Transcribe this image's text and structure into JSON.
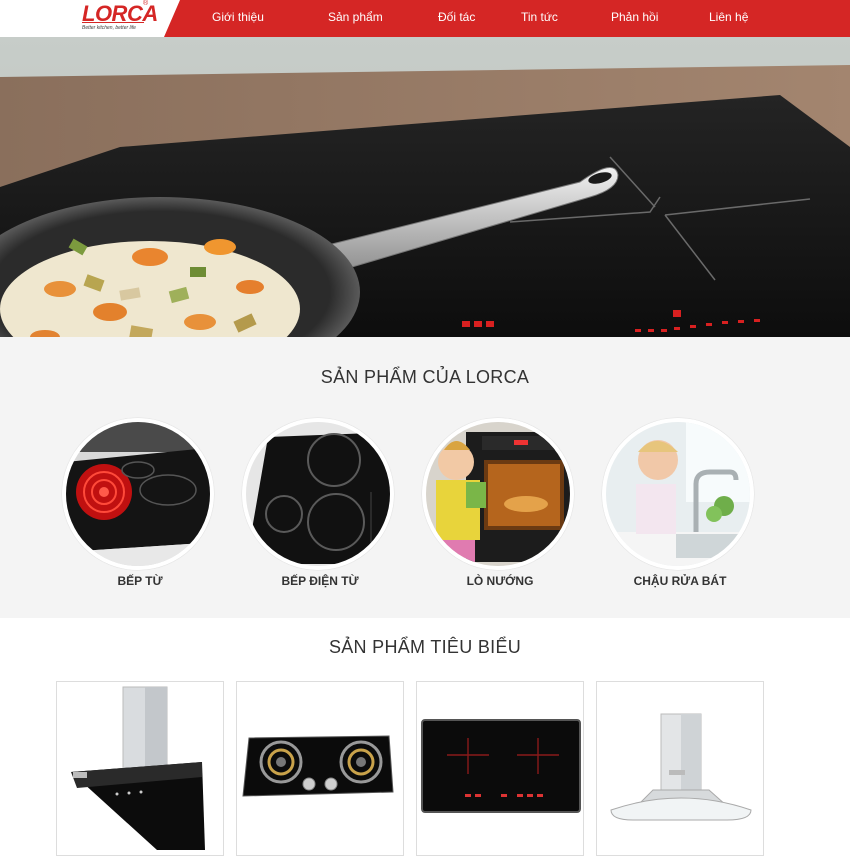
{
  "brand": {
    "name": "LORCA",
    "registered": "®",
    "tagline": "Better kitchen, better life"
  },
  "nav": {
    "items": [
      {
        "label": "Giới thiệu"
      },
      {
        "label": "Sản phẩm"
      },
      {
        "label": "Đối tác"
      },
      {
        "label": "Tin tức"
      },
      {
        "label": "Phản hồi"
      },
      {
        "label": "Liên hệ"
      }
    ]
  },
  "colors": {
    "brand_red": "#d52625",
    "section_bg": "#f4f4f4"
  },
  "categories": {
    "title": "SẢN PHẨM CỦA LORCA",
    "items": [
      {
        "label": "BẾP TỪ"
      },
      {
        "label": "BẾP ĐIỆN TỪ"
      },
      {
        "label": "LÒ NƯỚNG"
      },
      {
        "label": "CHẬU RỬA BÁT"
      }
    ]
  },
  "featured": {
    "title": "SẢN PHẨM TIÊU BIỂU"
  }
}
